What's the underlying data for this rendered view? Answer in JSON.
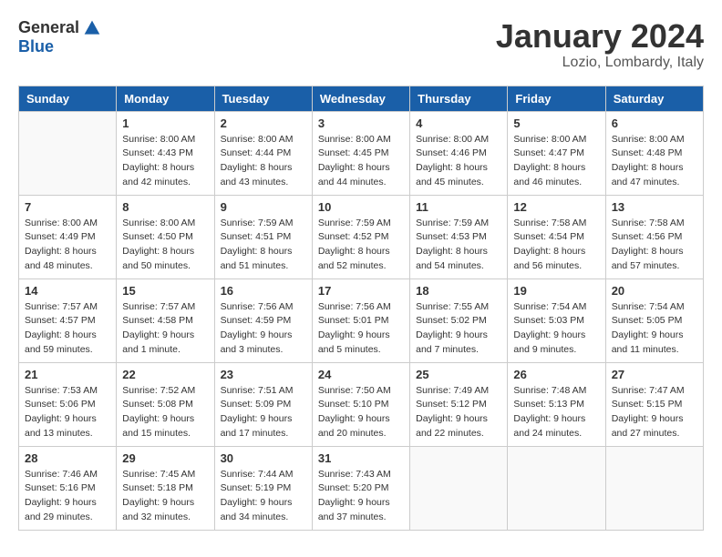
{
  "header": {
    "logo_general": "General",
    "logo_blue": "Blue",
    "month_title": "January 2024",
    "location": "Lozio, Lombardy, Italy"
  },
  "days_of_week": [
    "Sunday",
    "Monday",
    "Tuesday",
    "Wednesday",
    "Thursday",
    "Friday",
    "Saturday"
  ],
  "weeks": [
    [
      {
        "date": "",
        "sunrise": "",
        "sunset": "",
        "daylight": ""
      },
      {
        "date": "1",
        "sunrise": "Sunrise: 8:00 AM",
        "sunset": "Sunset: 4:43 PM",
        "daylight": "Daylight: 8 hours and 42 minutes."
      },
      {
        "date": "2",
        "sunrise": "Sunrise: 8:00 AM",
        "sunset": "Sunset: 4:44 PM",
        "daylight": "Daylight: 8 hours and 43 minutes."
      },
      {
        "date": "3",
        "sunrise": "Sunrise: 8:00 AM",
        "sunset": "Sunset: 4:45 PM",
        "daylight": "Daylight: 8 hours and 44 minutes."
      },
      {
        "date": "4",
        "sunrise": "Sunrise: 8:00 AM",
        "sunset": "Sunset: 4:46 PM",
        "daylight": "Daylight: 8 hours and 45 minutes."
      },
      {
        "date": "5",
        "sunrise": "Sunrise: 8:00 AM",
        "sunset": "Sunset: 4:47 PM",
        "daylight": "Daylight: 8 hours and 46 minutes."
      },
      {
        "date": "6",
        "sunrise": "Sunrise: 8:00 AM",
        "sunset": "Sunset: 4:48 PM",
        "daylight": "Daylight: 8 hours and 47 minutes."
      }
    ],
    [
      {
        "date": "7",
        "sunrise": "Sunrise: 8:00 AM",
        "sunset": "Sunset: 4:49 PM",
        "daylight": "Daylight: 8 hours and 48 minutes."
      },
      {
        "date": "8",
        "sunrise": "Sunrise: 8:00 AM",
        "sunset": "Sunset: 4:50 PM",
        "daylight": "Daylight: 8 hours and 50 minutes."
      },
      {
        "date": "9",
        "sunrise": "Sunrise: 7:59 AM",
        "sunset": "Sunset: 4:51 PM",
        "daylight": "Daylight: 8 hours and 51 minutes."
      },
      {
        "date": "10",
        "sunrise": "Sunrise: 7:59 AM",
        "sunset": "Sunset: 4:52 PM",
        "daylight": "Daylight: 8 hours and 52 minutes."
      },
      {
        "date": "11",
        "sunrise": "Sunrise: 7:59 AM",
        "sunset": "Sunset: 4:53 PM",
        "daylight": "Daylight: 8 hours and 54 minutes."
      },
      {
        "date": "12",
        "sunrise": "Sunrise: 7:58 AM",
        "sunset": "Sunset: 4:54 PM",
        "daylight": "Daylight: 8 hours and 56 minutes."
      },
      {
        "date": "13",
        "sunrise": "Sunrise: 7:58 AM",
        "sunset": "Sunset: 4:56 PM",
        "daylight": "Daylight: 8 hours and 57 minutes."
      }
    ],
    [
      {
        "date": "14",
        "sunrise": "Sunrise: 7:57 AM",
        "sunset": "Sunset: 4:57 PM",
        "daylight": "Daylight: 8 hours and 59 minutes."
      },
      {
        "date": "15",
        "sunrise": "Sunrise: 7:57 AM",
        "sunset": "Sunset: 4:58 PM",
        "daylight": "Daylight: 9 hours and 1 minute."
      },
      {
        "date": "16",
        "sunrise": "Sunrise: 7:56 AM",
        "sunset": "Sunset: 4:59 PM",
        "daylight": "Daylight: 9 hours and 3 minutes."
      },
      {
        "date": "17",
        "sunrise": "Sunrise: 7:56 AM",
        "sunset": "Sunset: 5:01 PM",
        "daylight": "Daylight: 9 hours and 5 minutes."
      },
      {
        "date": "18",
        "sunrise": "Sunrise: 7:55 AM",
        "sunset": "Sunset: 5:02 PM",
        "daylight": "Daylight: 9 hours and 7 minutes."
      },
      {
        "date": "19",
        "sunrise": "Sunrise: 7:54 AM",
        "sunset": "Sunset: 5:03 PM",
        "daylight": "Daylight: 9 hours and 9 minutes."
      },
      {
        "date": "20",
        "sunrise": "Sunrise: 7:54 AM",
        "sunset": "Sunset: 5:05 PM",
        "daylight": "Daylight: 9 hours and 11 minutes."
      }
    ],
    [
      {
        "date": "21",
        "sunrise": "Sunrise: 7:53 AM",
        "sunset": "Sunset: 5:06 PM",
        "daylight": "Daylight: 9 hours and 13 minutes."
      },
      {
        "date": "22",
        "sunrise": "Sunrise: 7:52 AM",
        "sunset": "Sunset: 5:08 PM",
        "daylight": "Daylight: 9 hours and 15 minutes."
      },
      {
        "date": "23",
        "sunrise": "Sunrise: 7:51 AM",
        "sunset": "Sunset: 5:09 PM",
        "daylight": "Daylight: 9 hours and 17 minutes."
      },
      {
        "date": "24",
        "sunrise": "Sunrise: 7:50 AM",
        "sunset": "Sunset: 5:10 PM",
        "daylight": "Daylight: 9 hours and 20 minutes."
      },
      {
        "date": "25",
        "sunrise": "Sunrise: 7:49 AM",
        "sunset": "Sunset: 5:12 PM",
        "daylight": "Daylight: 9 hours and 22 minutes."
      },
      {
        "date": "26",
        "sunrise": "Sunrise: 7:48 AM",
        "sunset": "Sunset: 5:13 PM",
        "daylight": "Daylight: 9 hours and 24 minutes."
      },
      {
        "date": "27",
        "sunrise": "Sunrise: 7:47 AM",
        "sunset": "Sunset: 5:15 PM",
        "daylight": "Daylight: 9 hours and 27 minutes."
      }
    ],
    [
      {
        "date": "28",
        "sunrise": "Sunrise: 7:46 AM",
        "sunset": "Sunset: 5:16 PM",
        "daylight": "Daylight: 9 hours and 29 minutes."
      },
      {
        "date": "29",
        "sunrise": "Sunrise: 7:45 AM",
        "sunset": "Sunset: 5:18 PM",
        "daylight": "Daylight: 9 hours and 32 minutes."
      },
      {
        "date": "30",
        "sunrise": "Sunrise: 7:44 AM",
        "sunset": "Sunset: 5:19 PM",
        "daylight": "Daylight: 9 hours and 34 minutes."
      },
      {
        "date": "31",
        "sunrise": "Sunrise: 7:43 AM",
        "sunset": "Sunset: 5:20 PM",
        "daylight": "Daylight: 9 hours and 37 minutes."
      },
      {
        "date": "",
        "sunrise": "",
        "sunset": "",
        "daylight": ""
      },
      {
        "date": "",
        "sunrise": "",
        "sunset": "",
        "daylight": ""
      },
      {
        "date": "",
        "sunrise": "",
        "sunset": "",
        "daylight": ""
      }
    ]
  ]
}
